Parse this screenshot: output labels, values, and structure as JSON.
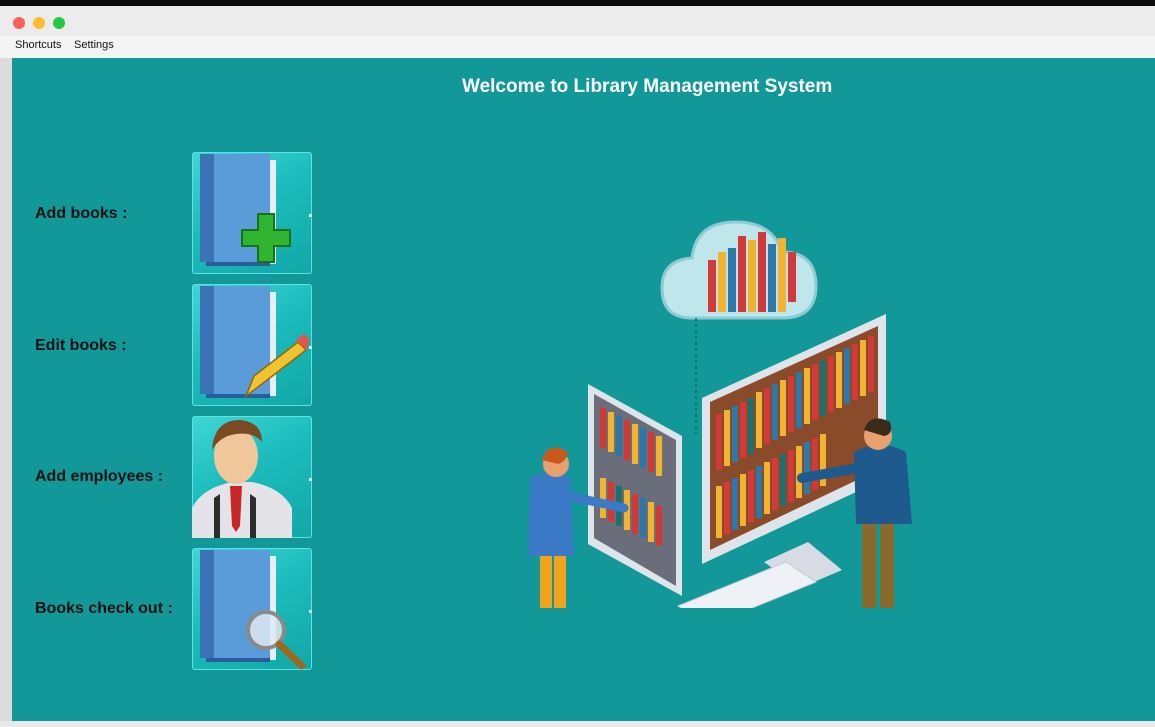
{
  "menu": {
    "shortcuts": "Shortcuts",
    "settings": "Settings"
  },
  "main": {
    "welcome": "Welcome to Library Management System",
    "actions": [
      {
        "label": "Add books :",
        "icon": "book-add-icon"
      },
      {
        "label": "Edit books :",
        "icon": "book-edit-icon"
      },
      {
        "label": "Add employees :",
        "icon": "employee-icon"
      },
      {
        "label": "Books check out :",
        "icon": "book-search-icon"
      }
    ]
  },
  "colors": {
    "background": "#129898",
    "button": "#1cbcbc",
    "title_text": "#ffffff"
  }
}
